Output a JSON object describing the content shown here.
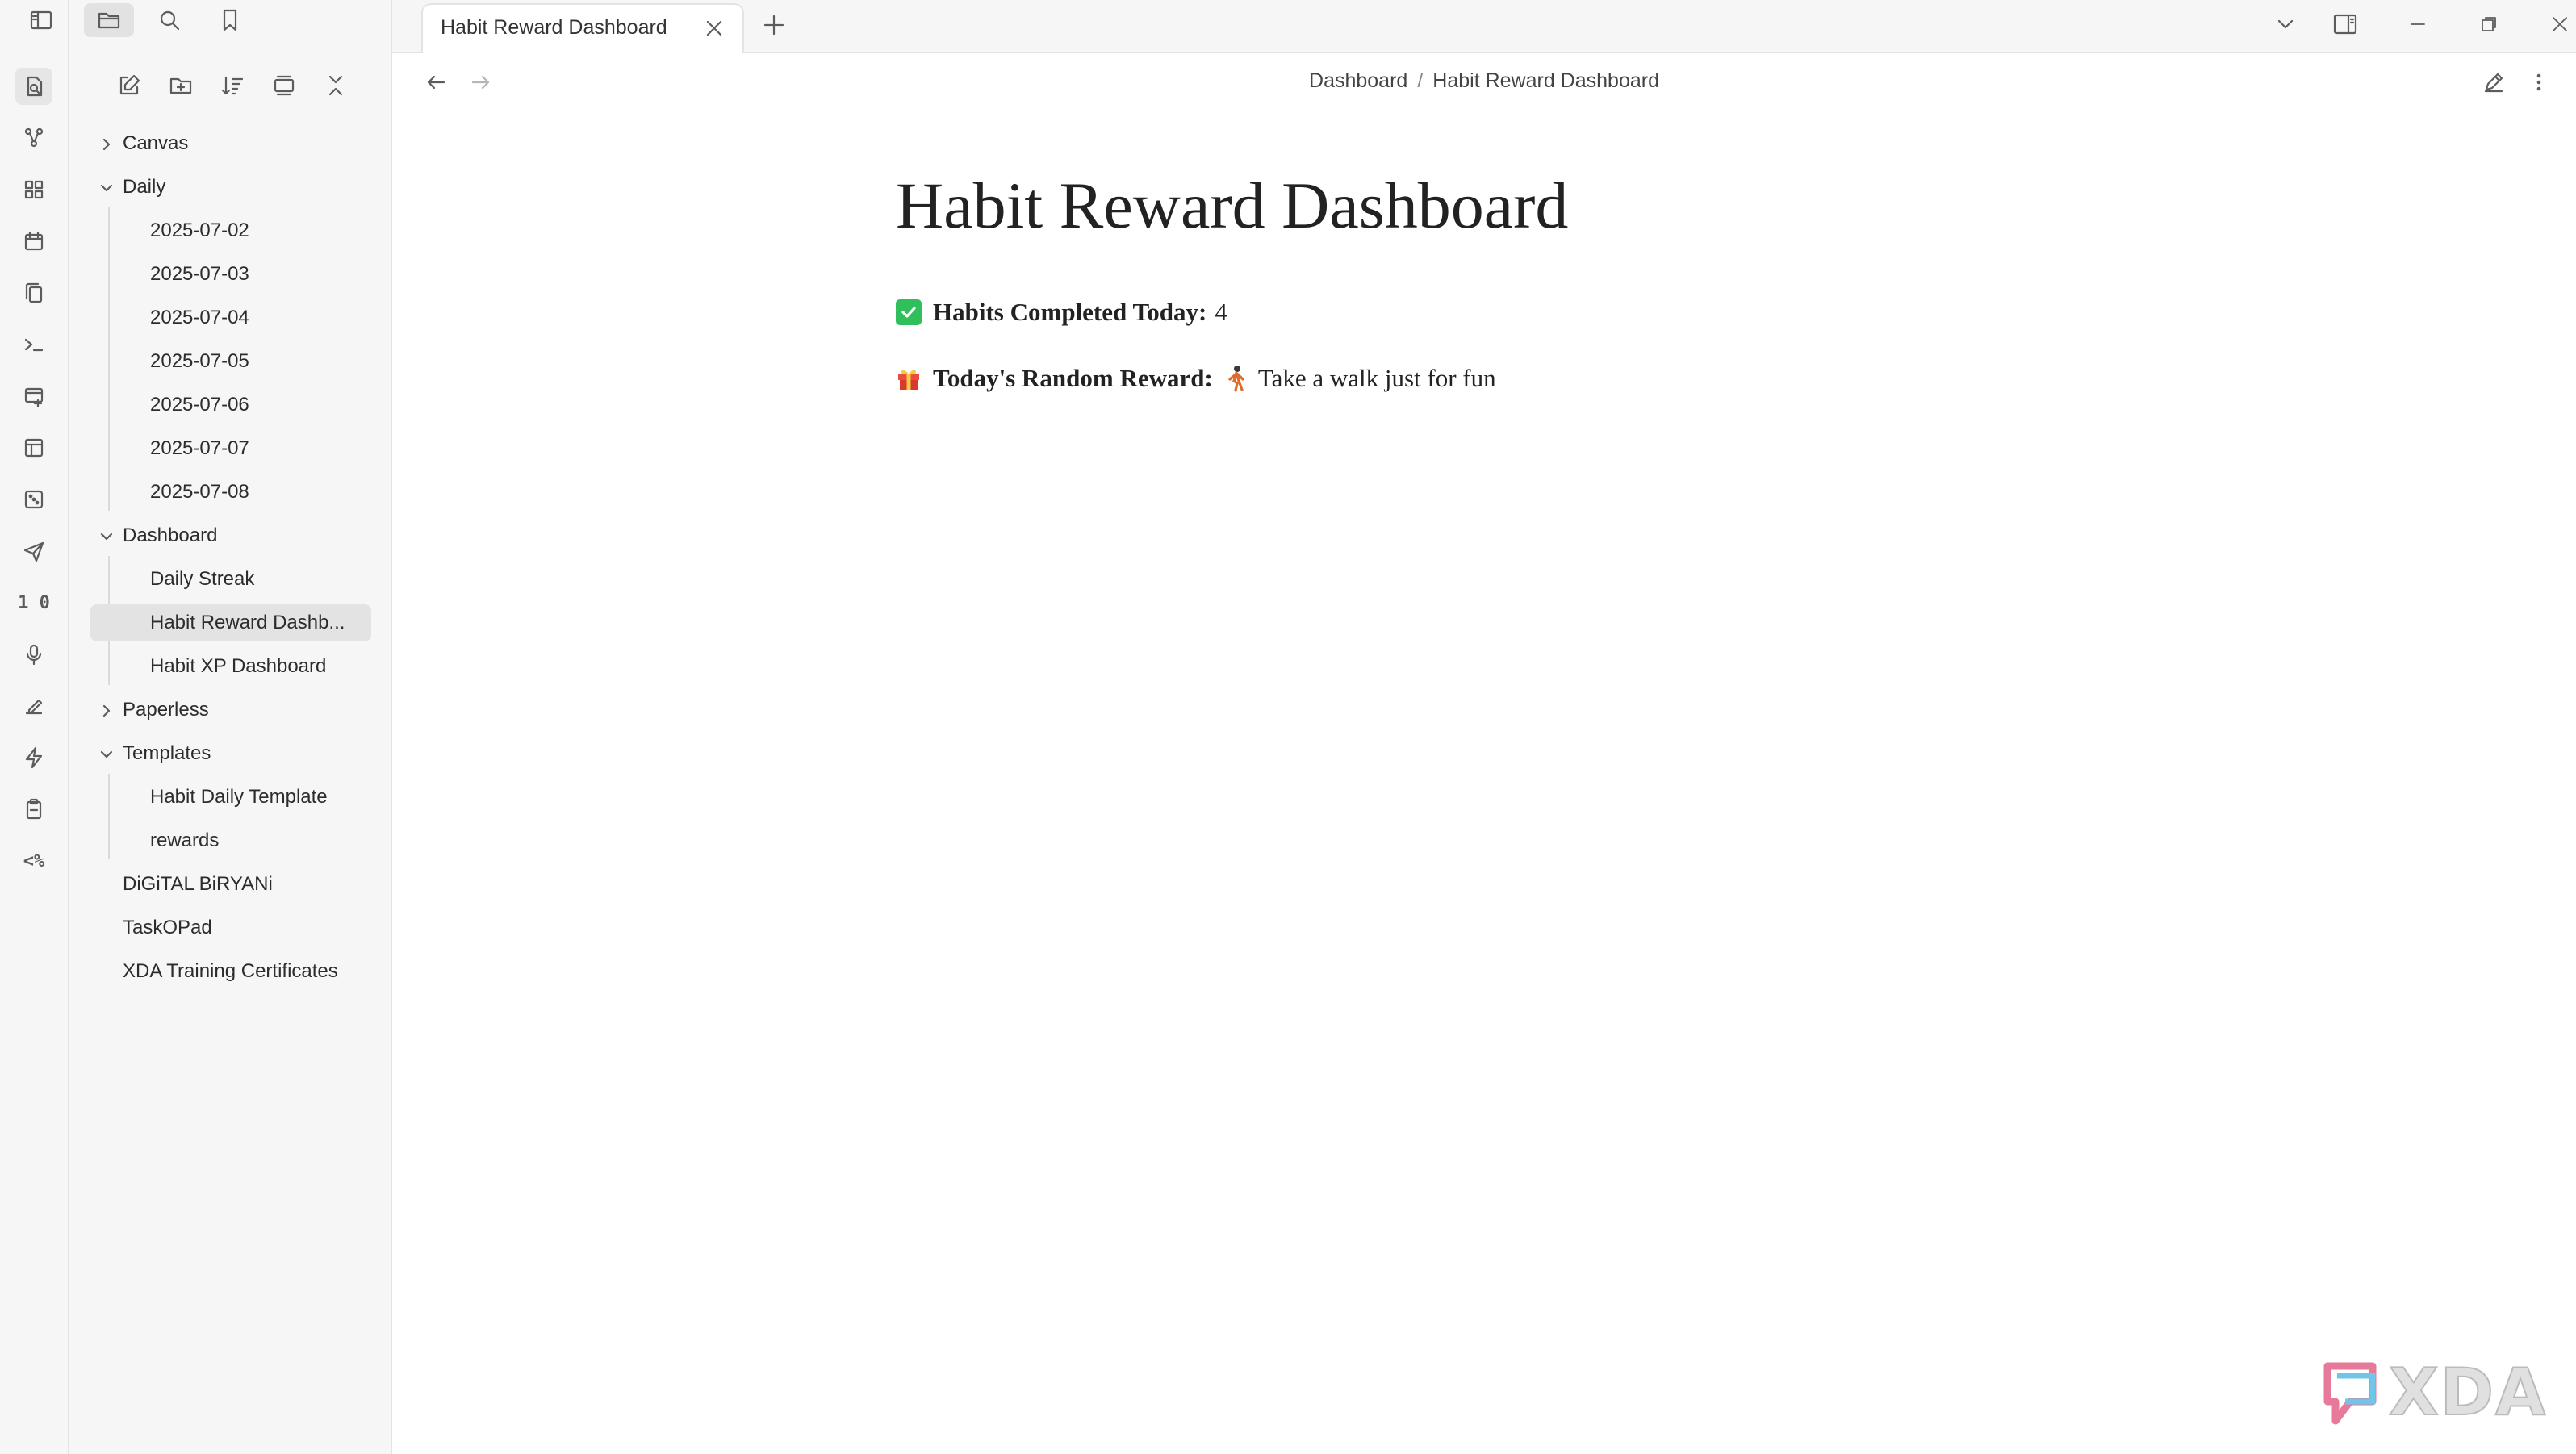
{
  "tab": {
    "title": "Habit Reward Dashboard"
  },
  "breadcrumb": {
    "parent": "Dashboard",
    "separator": "/",
    "current": "Habit Reward Dashboard"
  },
  "note": {
    "title": "Habit Reward Dashboard",
    "habits_label": "Habits Completed Today:",
    "habits_value": "4",
    "reward_label": "Today's Random Reward:",
    "reward_value": "Take a walk just for fun"
  },
  "tree": {
    "canvas": "Canvas",
    "daily": "Daily",
    "daily_items": [
      "2025-07-02",
      "2025-07-03",
      "2025-07-04",
      "2025-07-05",
      "2025-07-06",
      "2025-07-07",
      "2025-07-08"
    ],
    "dashboard": "Dashboard",
    "dashboard_items": [
      "Daily Streak",
      "Habit Reward Dashb...",
      "Habit XP Dashboard"
    ],
    "paperless": "Paperless",
    "templates": "Templates",
    "template_items": [
      "Habit Daily Template",
      "rewards"
    ],
    "root_files": [
      "DiGiTAL BiRYANi",
      "TaskOPad",
      "XDA Training Certificates"
    ]
  },
  "ribbon": {
    "percent_label": "<%",
    "numbers_label": "1 0"
  },
  "watermark": {
    "text": "XDA"
  },
  "colors": {
    "check_green": "#2fbf5b",
    "selected_bg": "#e3e3e3",
    "sidebar_bg": "#f6f6f6"
  },
  "icons": [
    "sidebar-toggle-icon",
    "folder-icon",
    "search-icon",
    "bookmark-icon",
    "new-note-icon",
    "new-folder-icon",
    "sort-icon",
    "collapse-icon",
    "expand-icon",
    "back-arrow-icon",
    "forward-arrow-icon",
    "edit-icon",
    "more-icon",
    "close-icon",
    "plus-icon",
    "chevron-down-icon",
    "split-view-icon",
    "minimize-icon",
    "restore-icon"
  ]
}
